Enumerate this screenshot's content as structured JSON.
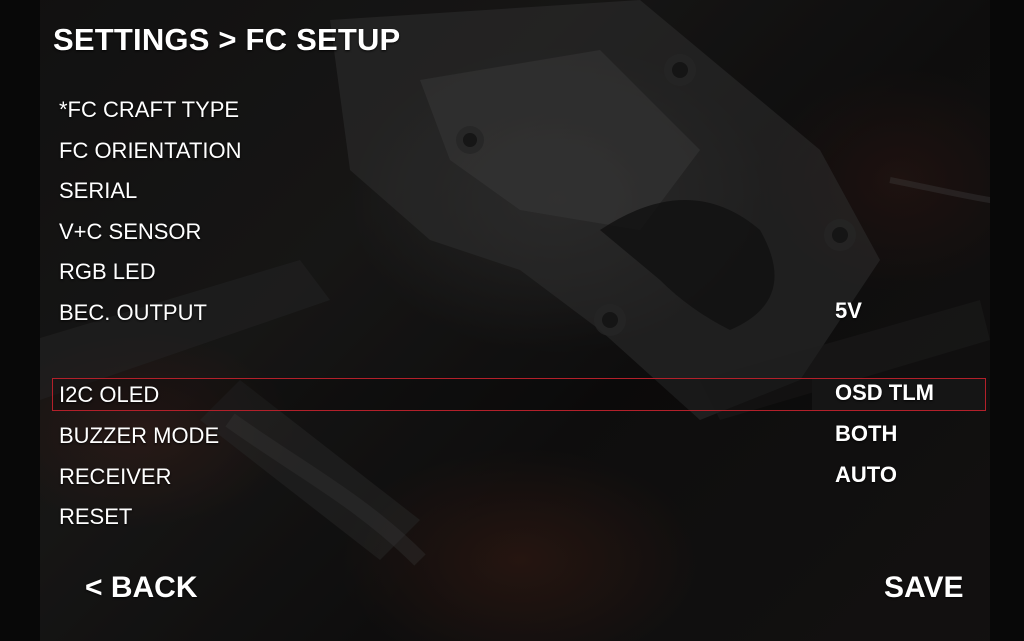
{
  "header": {
    "title": "SETTINGS > FC SETUP"
  },
  "menu": {
    "items": [
      {
        "label": "*FC CRAFT TYPE",
        "value": ""
      },
      {
        "label": "FC ORIENTATION",
        "value": ""
      },
      {
        "label": "SERIAL",
        "value": ""
      },
      {
        "label": "V+C SENSOR",
        "value": ""
      },
      {
        "label": "RGB LED",
        "value": ""
      },
      {
        "label": "BEC. OUTPUT",
        "value": "5V"
      },
      {
        "label": "I2C OLED",
        "value": "OSD TLM",
        "selected": true
      },
      {
        "label": "BUZZER MODE",
        "value": "BOTH"
      },
      {
        "label": "RECEIVER",
        "value": "AUTO"
      },
      {
        "label": "RESET",
        "value": ""
      }
    ]
  },
  "footer": {
    "back_label": "< BACK",
    "save_label": "SAVE"
  },
  "colors": {
    "text": "#ffffff",
    "selection_border": "#b3202a",
    "background": "#1b1a1a"
  }
}
